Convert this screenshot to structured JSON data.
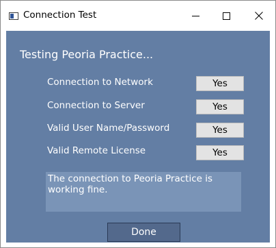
{
  "window": {
    "title": "Connection Test",
    "icon": "app-window-icon",
    "controls": {
      "minimize_icon": "minimize-icon",
      "maximize_icon": "maximize-icon",
      "close_glyph": "✕"
    }
  },
  "dialog": {
    "heading": "Testing Peoria Practice...",
    "checks": [
      {
        "label": "Connection to Network",
        "value": "Yes"
      },
      {
        "label": "Connection to Server",
        "value": "Yes"
      },
      {
        "label": "Valid User Name/Password",
        "value": "Yes"
      },
      {
        "label": "Valid Remote License",
        "value": "Yes"
      }
    ],
    "message": "The connection to Peoria Practice is working fine.",
    "done_label": "Done"
  },
  "colors": {
    "panel_background": "#637ea4",
    "message_background": "#7a94b7",
    "value_box_background": "#e3e3e3",
    "done_button_background": "#53698c"
  }
}
